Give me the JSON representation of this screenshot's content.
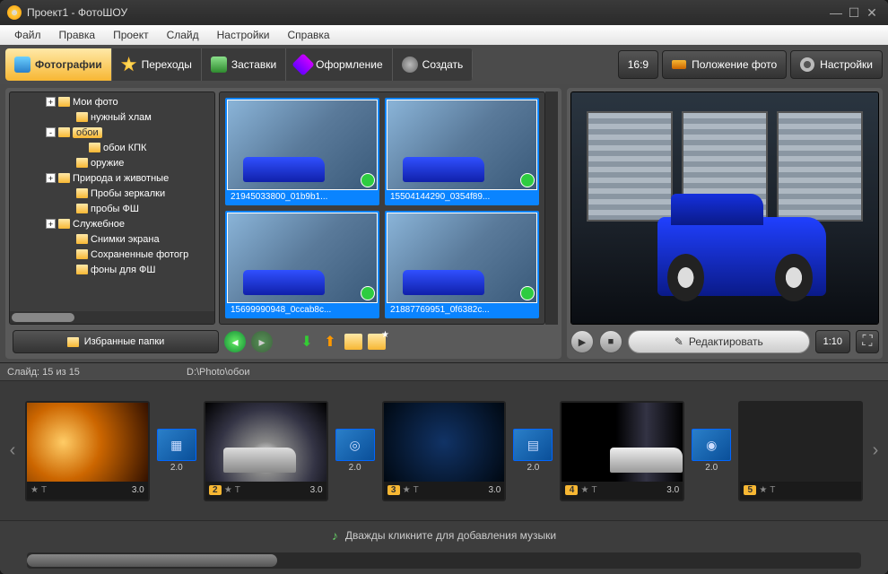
{
  "window": {
    "title": "Проект1 - ФотоШОУ"
  },
  "menu": [
    "Файл",
    "Правка",
    "Проект",
    "Слайд",
    "Настройки",
    "Справка"
  ],
  "tabs": {
    "photos": "Фотографии",
    "transitions": "Переходы",
    "splash": "Заставки",
    "design": "Оформление",
    "create": "Создать"
  },
  "right_toolbar": {
    "aspect": "16:9",
    "photo_pos": "Положение фото",
    "settings": "Настройки"
  },
  "folders": [
    {
      "label": "Мои фото",
      "exp": "+",
      "indent": 40
    },
    {
      "label": "нужный хлам",
      "exp": "",
      "indent": 58
    },
    {
      "label": "обои",
      "exp": "-",
      "indent": 40,
      "selected": true
    },
    {
      "label": "обои КПК",
      "exp": "",
      "indent": 72
    },
    {
      "label": "оружие",
      "exp": "",
      "indent": 58
    },
    {
      "label": "Природа и животные",
      "exp": "+",
      "indent": 40
    },
    {
      "label": "Пробы зеркалки",
      "exp": "",
      "indent": 58
    },
    {
      "label": "пробы ФШ",
      "exp": "",
      "indent": 58
    },
    {
      "label": "Служебное",
      "exp": "+",
      "indent": 40
    },
    {
      "label": "Снимки экрана",
      "exp": "",
      "indent": 58
    },
    {
      "label": "Сохраненные фотогр",
      "exp": "",
      "indent": 58
    },
    {
      "label": "фоны для ФШ",
      "exp": "",
      "indent": 58
    }
  ],
  "thumbs": [
    "21945033800_01b9b1...",
    "15504144290_0354f89...",
    "15699990948_0ccab8c...",
    "21887769951_0f6382c..."
  ],
  "fav_folders": "Избранные папки",
  "preview": {
    "edit": "Редактировать",
    "time": "1:10"
  },
  "timeline": {
    "slide_count": "Слайд: 15 из 15",
    "path": "D:\\Photo\\обои",
    "music_hint": "Дважды кликните для добавления музыки",
    "slides": [
      {
        "num": "",
        "dur": "3.0",
        "cls": "s1",
        "showT": true
      },
      {
        "num": "2",
        "dur": "3.0",
        "cls": "s2",
        "car": true
      },
      {
        "num": "3",
        "dur": "3.0",
        "cls": "s3"
      },
      {
        "num": "4",
        "dur": "3.0",
        "cls": "s4",
        "car": true
      },
      {
        "num": "5",
        "dur": "",
        "cls": "s5"
      }
    ],
    "trans_dur": "2.0"
  }
}
